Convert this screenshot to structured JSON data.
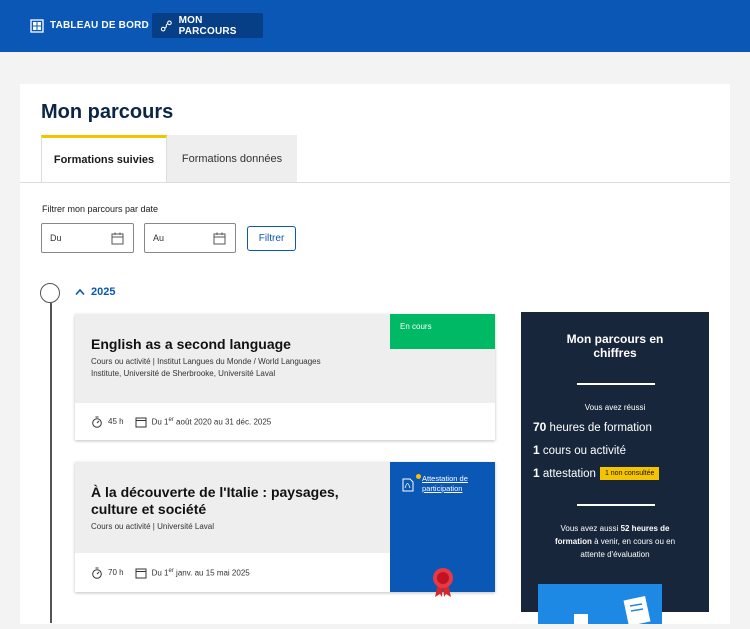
{
  "nav": {
    "items": [
      {
        "label": "TABLEAU DE BORD",
        "icon": "dashboard-icon"
      },
      {
        "label": "MON PARCOURS",
        "icon": "path-icon"
      }
    ]
  },
  "page": {
    "title": "Mon parcours"
  },
  "tabs": [
    {
      "label": "Formations suivies",
      "active": true
    },
    {
      "label": "Formations données",
      "active": false
    }
  ],
  "filter": {
    "label": "Filtrer mon parcours par date",
    "from_placeholder": "Du",
    "to_placeholder": "Au",
    "button": "Filtrer"
  },
  "timeline": {
    "year": "2025"
  },
  "courses": [
    {
      "title": "English as a second language",
      "meta_line1": "Cours ou activité | Institut Langues du Monde / World Languages",
      "meta_line2": "Institute, Université de Sherbrooke, Université Laval",
      "hours": "45 h",
      "dates_prefix": "Du 1",
      "dates_sup": "er",
      "dates_suffix": " août 2020 au 31 déc. 2025",
      "status": "En cours"
    },
    {
      "title_line1": "À la découverte de l'Italie : paysages,",
      "title_line2": "culture et société",
      "meta_line1": "Cours ou activité | Université Laval",
      "hours": "70 h",
      "dates_prefix": "Du 1",
      "dates_sup": "er",
      "dates_suffix": " janv. au 15 mai 2025",
      "attestation_line1": "Attestation de",
      "attestation_line2": "participation"
    }
  ],
  "stats": {
    "title_line1": "Mon parcours en",
    "title_line2": "chiffres",
    "success_label": "Vous avez réussi",
    "hours_value": "70",
    "hours_label": " heures de formation",
    "courses_value": "1",
    "courses_label": " cours ou activité",
    "attest_value": "1",
    "attest_label": " attestation",
    "attest_badge": "1 non consultée",
    "also_line1_prefix": "Vous avez aussi ",
    "also_line1_bold": "52 heures de",
    "also_line2_bold": "formation",
    "also_line2_rest": " à venir, en cours ou en",
    "also_line3": "attente d'évaluation"
  },
  "colors": {
    "primary": "#0b57b5",
    "accent": "#f5c400",
    "status_green": "#00b964",
    "stats_bg": "#17263a"
  }
}
